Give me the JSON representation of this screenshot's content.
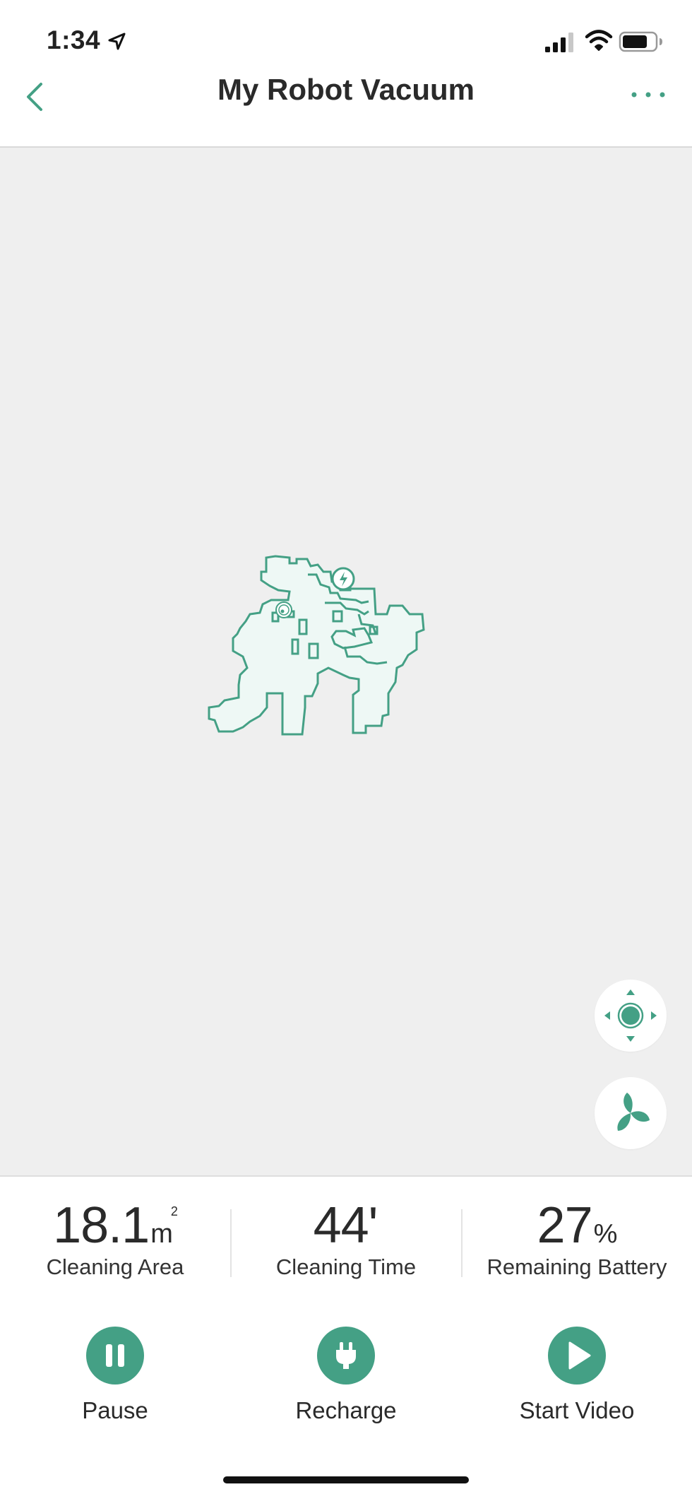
{
  "status_bar": {
    "time": "1:34"
  },
  "header": {
    "title": "My Robot Vacuum"
  },
  "stats": [
    {
      "value": "18.1",
      "unit": "m",
      "unit_sup": "2",
      "label": "Cleaning Area"
    },
    {
      "value": "44'",
      "unit": "",
      "unit_sup": "",
      "label": "Cleaning Time"
    },
    {
      "value": "27",
      "unit": "%",
      "unit_sup": "",
      "label": "Remaining Battery"
    }
  ],
  "actions": [
    {
      "label": "Pause",
      "icon": "pause-icon"
    },
    {
      "label": "Recharge",
      "icon": "plug-icon"
    },
    {
      "label": "Start Video",
      "icon": "play-icon"
    }
  ],
  "colors": {
    "accent": "#44a085",
    "map_fill": "#eef8f5",
    "map_background": "#efefef"
  }
}
